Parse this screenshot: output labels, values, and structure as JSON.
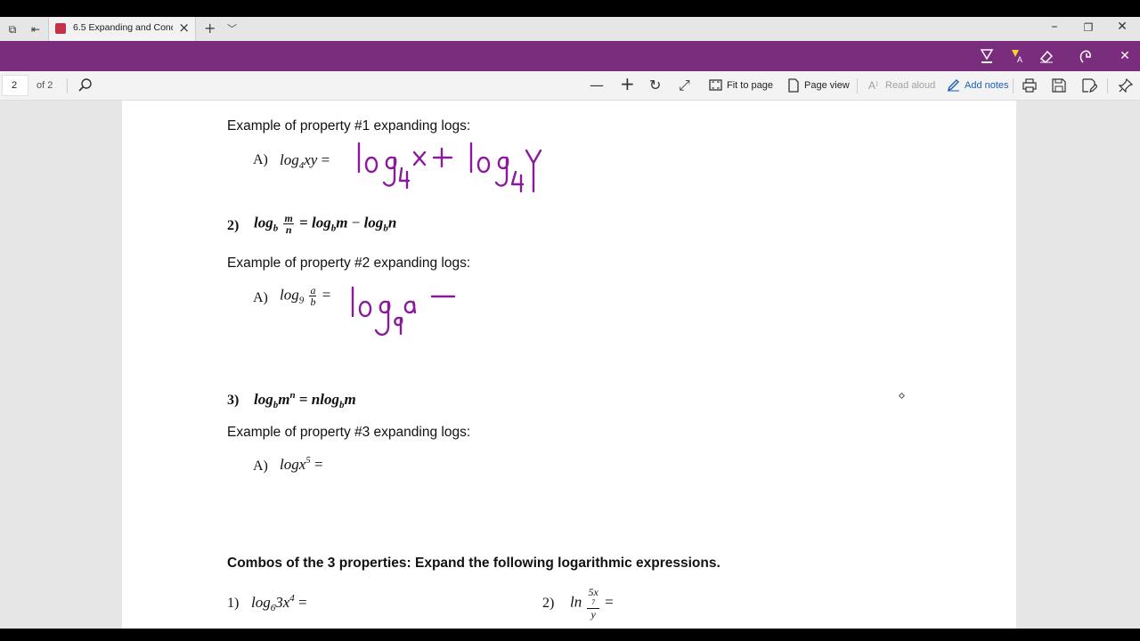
{
  "browser": {
    "tab_title": "6.5 Expanding and Cond",
    "new_tab_icon": "plus-icon",
    "window_buttons": [
      "minimize",
      "restore",
      "close"
    ]
  },
  "pdf_toolbar": {
    "page_number": "2",
    "page_total": "of 2",
    "fit_to_page": "Fit to page",
    "page_view": "Page view",
    "read_aloud": "Read aloud",
    "add_notes": "Add notes"
  },
  "colors": {
    "ink_bar": "#7b2d7d",
    "ink": "#8a1a9c",
    "accent": "#1a5fb4"
  },
  "document": {
    "ex1_heading": "Example of property #1 expanding logs:",
    "ex1_label": "A)",
    "prop2_label": "2)",
    "ex2_heading": "Example of property #2 expanding logs:",
    "ex2_label": "A)",
    "prop3_label": "3)",
    "ex3_heading": "Example of property #3 expanding logs:",
    "ex3_label": "A)",
    "combos_heading": "Combos of the 3 properties: Expand the following logarithmic expressions.",
    "combo1_label": "1)",
    "combo2_label": "2)",
    "math": {
      "log": "log",
      "ln": "ln",
      "eq": "=",
      "minus": "−",
      "ex1_base": "4",
      "ex1_arg": "xy",
      "p2_base": "b",
      "p2_num": "m",
      "p2_den": "n",
      "p2_rhs_arg1": "m",
      "p2_rhs_arg2": "n",
      "ex2_base": "9",
      "ex2_num": "a",
      "ex2_den": "b",
      "p3_base": "b",
      "p3_arg": "m",
      "p3_exp": "n",
      "p3_coef": "n",
      "ex3_arg": "x",
      "ex3_exp": "5",
      "c1_base": "6",
      "c1_arg": "3x",
      "c1_exp": "4",
      "c2_num": "5x",
      "c2_num_exp": "7",
      "c2_den": "y"
    }
  }
}
